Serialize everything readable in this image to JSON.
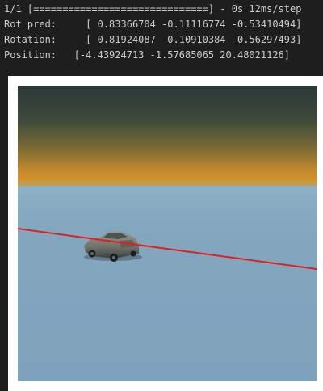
{
  "console": {
    "lines": [
      "1/1 [==============================] - 0s 12ms/step",
      "Rot pred:     [ 0.83366704 -0.11116774 -0.53410494]",
      "Rotation:     [ 0.81924087 -0.10910384 -0.56297493]",
      "Position:   [-4.43924713 -1.57685065 20.48021126]"
    ],
    "text_color": "#cccccc",
    "background": "#1e1e1e"
  },
  "figure": {
    "sky_top_color": "#2a3a3a",
    "horizon_glow_color": "#d7972a",
    "ground_color": "#7fa3bd",
    "line_color": "#e02020",
    "icons": [
      "car-icon"
    ]
  }
}
